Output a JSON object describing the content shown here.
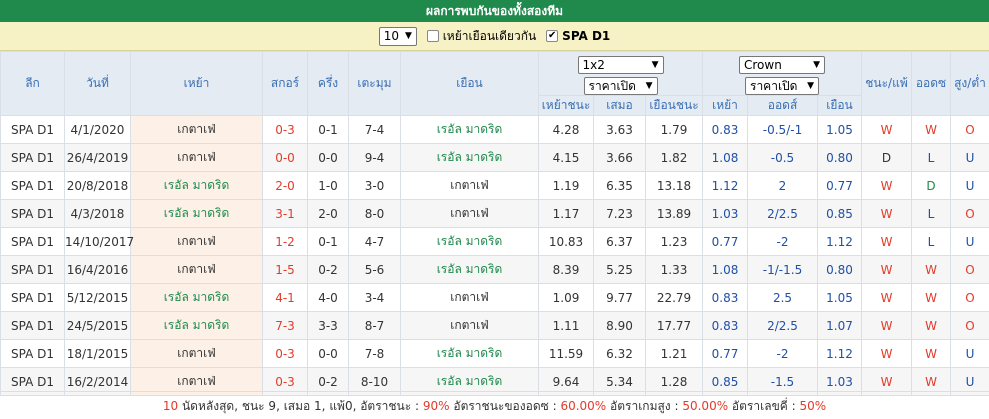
{
  "title": "ผลการพบกันของทั้งสองทีม",
  "filter": {
    "count_value": "10",
    "same_home_label": "เหย้าเยือนเดียวกัน",
    "same_home_checked": false,
    "league_label": "SPA D1",
    "league_checked": true
  },
  "headers": {
    "league": "ลีก",
    "date": "วันที่",
    "home": "เหย้า",
    "score": "สกอร์",
    "half": "ครึ่ง",
    "corner": "เตะมุม",
    "away": "เยือน",
    "odds_select": "1x2",
    "odds_price_select": "ราคาเปิด",
    "odds_home_win": "เหย้าชนะ",
    "odds_draw": "เสมอ",
    "odds_away_win": "เยือนชนะ",
    "ah_select": "Crown",
    "ah_price_select": "ราคาเปิด",
    "ah_home": "เหย้า",
    "ah_odds": "ออดส์",
    "ah_away": "เยือน",
    "win_lose": "ชนะ/แพ้",
    "odds_result": "ออดซ",
    "over_under": "สูง/ต่ำ"
  },
  "rows": [
    {
      "league": "SPA D1",
      "date": "4/1/2020",
      "home": "เกตาเฟ่",
      "score": "0-3",
      "half": "0-1",
      "corner": "7-4",
      "away": "เรอัล มาดริด",
      "o1": "4.28",
      "ox": "3.63",
      "o2": "1.79",
      "ah1": "0.83",
      "ahv": "-0.5/-1",
      "ah2": "1.05",
      "r1": "W",
      "r2": "W",
      "r3": "O"
    },
    {
      "league": "SPA D1",
      "date": "26/4/2019",
      "home": "เกตาเฟ่",
      "score": "0-0",
      "half": "0-0",
      "corner": "9-4",
      "away": "เรอัล มาดริด",
      "o1": "4.15",
      "ox": "3.66",
      "o2": "1.82",
      "ah1": "1.08",
      "ahv": "-0.5",
      "ah2": "0.80",
      "r1": "D",
      "r2": "L",
      "r3": "U"
    },
    {
      "league": "SPA D1",
      "date": "20/8/2018",
      "home": "เรอัล มาดริด",
      "score": "2-0",
      "half": "1-0",
      "corner": "3-0",
      "away": "เกตาเฟ่",
      "o1": "1.19",
      "ox": "6.35",
      "o2": "13.18",
      "ah1": "1.12",
      "ahv": "2",
      "ah2": "0.77",
      "r1": "W",
      "r2": "D",
      "r3": "U"
    },
    {
      "league": "SPA D1",
      "date": "4/3/2018",
      "home": "เรอัล มาดริด",
      "score": "3-1",
      "half": "2-0",
      "corner": "8-0",
      "away": "เกตาเฟ่",
      "o1": "1.17",
      "ox": "7.23",
      "o2": "13.89",
      "ah1": "1.03",
      "ahv": "2/2.5",
      "ah2": "0.85",
      "r1": "W",
      "r2": "L",
      "r3": "O"
    },
    {
      "league": "SPA D1",
      "date": "14/10/2017",
      "home": "เกตาเฟ่",
      "score": "1-2",
      "half": "0-1",
      "corner": "4-7",
      "away": "เรอัล มาดริด",
      "o1": "10.83",
      "ox": "6.37",
      "o2": "1.23",
      "ah1": "0.77",
      "ahv": "-2",
      "ah2": "1.12",
      "r1": "W",
      "r2": "L",
      "r3": "U"
    },
    {
      "league": "SPA D1",
      "date": "16/4/2016",
      "home": "เกตาเฟ่",
      "score": "1-5",
      "half": "0-2",
      "corner": "5-6",
      "away": "เรอัล มาดริด",
      "o1": "8.39",
      "ox": "5.25",
      "o2": "1.33",
      "ah1": "1.08",
      "ahv": "-1/-1.5",
      "ah2": "0.80",
      "r1": "W",
      "r2": "W",
      "r3": "O"
    },
    {
      "league": "SPA D1",
      "date": "5/12/2015",
      "home": "เรอัล มาดริด",
      "score": "4-1",
      "half": "4-0",
      "corner": "3-4",
      "away": "เกตาเฟ่",
      "o1": "1.09",
      "ox": "9.77",
      "o2": "22.79",
      "ah1": "0.83",
      "ahv": "2.5",
      "ah2": "1.05",
      "r1": "W",
      "r2": "W",
      "r3": "O"
    },
    {
      "league": "SPA D1",
      "date": "24/5/2015",
      "home": "เรอัล มาดริด",
      "score": "7-3",
      "half": "3-3",
      "corner": "8-7",
      "away": "เกตาเฟ่",
      "o1": "1.11",
      "ox": "8.90",
      "o2": "17.77",
      "ah1": "0.83",
      "ahv": "2/2.5",
      "ah2": "1.07",
      "r1": "W",
      "r2": "W",
      "r3": "O"
    },
    {
      "league": "SPA D1",
      "date": "18/1/2015",
      "home": "เกตาเฟ่",
      "score": "0-3",
      "half": "0-0",
      "corner": "7-8",
      "away": "เรอัล มาดริด",
      "o1": "11.59",
      "ox": "6.32",
      "o2": "1.21",
      "ah1": "0.77",
      "ahv": "-2",
      "ah2": "1.12",
      "r1": "W",
      "r2": "W",
      "r3": "U"
    },
    {
      "league": "SPA D1",
      "date": "16/2/2014",
      "home": "เกตาเฟ่",
      "score": "0-3",
      "half": "0-2",
      "corner": "8-10",
      "away": "เรอัล มาดริด",
      "o1": "9.64",
      "ox": "5.34",
      "o2": "1.28",
      "ah1": "0.85",
      "ahv": "-1.5",
      "ah2": "1.03",
      "r1": "W",
      "r2": "W",
      "r3": "U"
    }
  ],
  "summary": {
    "count": "10",
    "text1": " นัดหลังสุด, ชนะ 9, เสมอ 1, แพ้0, อัตราชนะ : ",
    "win_rate": "90%",
    "text2": " อัตราชนะของอดซ : ",
    "odds_rate": "60.00%",
    "text3": " อัตราเกมสูง : ",
    "over_rate": "50.00%",
    "text4": " อัตราเลขคี่ : ",
    "odd_rate": "50%"
  },
  "colors": {
    "title_bg": "#1f8a4c",
    "filter_bg": "#f7f2c6",
    "header_bg": "#e4ebf2",
    "header_text": "#3a6fb4",
    "home_cell_bg": "#fdf1e7",
    "red": "#e23b2a",
    "green": "#1f8a4c",
    "blue": "#1f4fa8"
  },
  "featured_team": "เรอัล มาดริด"
}
